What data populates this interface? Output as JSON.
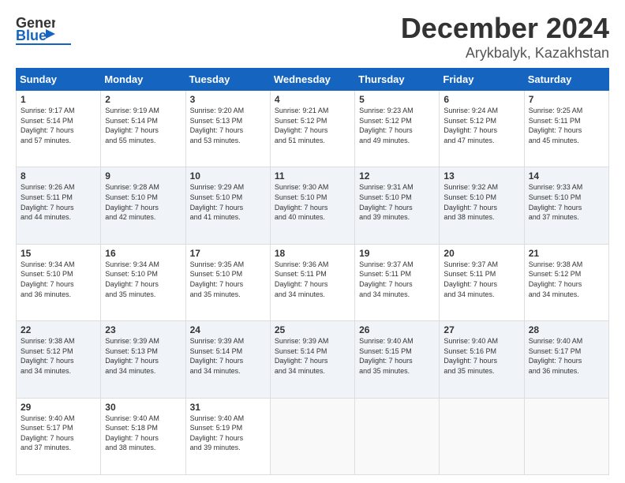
{
  "header": {
    "logo_line1": "General",
    "logo_line2": "Blue",
    "main_title": "December 2024",
    "subtitle": "Arykbalyk, Kazakhstan"
  },
  "calendar": {
    "headers": [
      "Sunday",
      "Monday",
      "Tuesday",
      "Wednesday",
      "Thursday",
      "Friday",
      "Saturday"
    ],
    "weeks": [
      [
        {
          "day": "",
          "info": ""
        },
        {
          "day": "2",
          "info": "Sunrise: 9:19 AM\nSunset: 5:14 PM\nDaylight: 7 hours\nand 55 minutes."
        },
        {
          "day": "3",
          "info": "Sunrise: 9:20 AM\nSunset: 5:13 PM\nDaylight: 7 hours\nand 53 minutes."
        },
        {
          "day": "4",
          "info": "Sunrise: 9:21 AM\nSunset: 5:12 PM\nDaylight: 7 hours\nand 51 minutes."
        },
        {
          "day": "5",
          "info": "Sunrise: 9:23 AM\nSunset: 5:12 PM\nDaylight: 7 hours\nand 49 minutes."
        },
        {
          "day": "6",
          "info": "Sunrise: 9:24 AM\nSunset: 5:12 PM\nDaylight: 7 hours\nand 47 minutes."
        },
        {
          "day": "7",
          "info": "Sunrise: 9:25 AM\nSunset: 5:11 PM\nDaylight: 7 hours\nand 45 minutes."
        }
      ],
      [
        {
          "day": "1",
          "info": "Sunrise: 9:17 AM\nSunset: 5:14 PM\nDaylight: 7 hours\nand 57 minutes."
        },
        null,
        null,
        null,
        null,
        null,
        null
      ],
      [
        {
          "day": "8",
          "info": "Sunrise: 9:26 AM\nSunset: 5:11 PM\nDaylight: 7 hours\nand 44 minutes."
        },
        {
          "day": "9",
          "info": "Sunrise: 9:28 AM\nSunset: 5:10 PM\nDaylight: 7 hours\nand 42 minutes."
        },
        {
          "day": "10",
          "info": "Sunrise: 9:29 AM\nSunset: 5:10 PM\nDaylight: 7 hours\nand 41 minutes."
        },
        {
          "day": "11",
          "info": "Sunrise: 9:30 AM\nSunset: 5:10 PM\nDaylight: 7 hours\nand 40 minutes."
        },
        {
          "day": "12",
          "info": "Sunrise: 9:31 AM\nSunset: 5:10 PM\nDaylight: 7 hours\nand 39 minutes."
        },
        {
          "day": "13",
          "info": "Sunrise: 9:32 AM\nSunset: 5:10 PM\nDaylight: 7 hours\nand 38 minutes."
        },
        {
          "day": "14",
          "info": "Sunrise: 9:33 AM\nSunset: 5:10 PM\nDaylight: 7 hours\nand 37 minutes."
        }
      ],
      [
        {
          "day": "15",
          "info": "Sunrise: 9:34 AM\nSunset: 5:10 PM\nDaylight: 7 hours\nand 36 minutes."
        },
        {
          "day": "16",
          "info": "Sunrise: 9:34 AM\nSunset: 5:10 PM\nDaylight: 7 hours\nand 35 minutes."
        },
        {
          "day": "17",
          "info": "Sunrise: 9:35 AM\nSunset: 5:10 PM\nDaylight: 7 hours\nand 35 minutes."
        },
        {
          "day": "18",
          "info": "Sunrise: 9:36 AM\nSunset: 5:11 PM\nDaylight: 7 hours\nand 34 minutes."
        },
        {
          "day": "19",
          "info": "Sunrise: 9:37 AM\nSunset: 5:11 PM\nDaylight: 7 hours\nand 34 minutes."
        },
        {
          "day": "20",
          "info": "Sunrise: 9:37 AM\nSunset: 5:11 PM\nDaylight: 7 hours\nand 34 minutes."
        },
        {
          "day": "21",
          "info": "Sunrise: 9:38 AM\nSunset: 5:12 PM\nDaylight: 7 hours\nand 34 minutes."
        }
      ],
      [
        {
          "day": "22",
          "info": "Sunrise: 9:38 AM\nSunset: 5:12 PM\nDaylight: 7 hours\nand 34 minutes."
        },
        {
          "day": "23",
          "info": "Sunrise: 9:39 AM\nSunset: 5:13 PM\nDaylight: 7 hours\nand 34 minutes."
        },
        {
          "day": "24",
          "info": "Sunrise: 9:39 AM\nSunset: 5:14 PM\nDaylight: 7 hours\nand 34 minutes."
        },
        {
          "day": "25",
          "info": "Sunrise: 9:39 AM\nSunset: 5:14 PM\nDaylight: 7 hours\nand 34 minutes."
        },
        {
          "day": "26",
          "info": "Sunrise: 9:40 AM\nSunset: 5:15 PM\nDaylight: 7 hours\nand 35 minutes."
        },
        {
          "day": "27",
          "info": "Sunrise: 9:40 AM\nSunset: 5:16 PM\nDaylight: 7 hours\nand 35 minutes."
        },
        {
          "day": "28",
          "info": "Sunrise: 9:40 AM\nSunset: 5:17 PM\nDaylight: 7 hours\nand 36 minutes."
        }
      ],
      [
        {
          "day": "29",
          "info": "Sunrise: 9:40 AM\nSunset: 5:17 PM\nDaylight: 7 hours\nand 37 minutes."
        },
        {
          "day": "30",
          "info": "Sunrise: 9:40 AM\nSunset: 5:18 PM\nDaylight: 7 hours\nand 38 minutes."
        },
        {
          "day": "31",
          "info": "Sunrise: 9:40 AM\nSunset: 5:19 PM\nDaylight: 7 hours\nand 39 minutes."
        },
        {
          "day": "",
          "info": ""
        },
        {
          "day": "",
          "info": ""
        },
        {
          "day": "",
          "info": ""
        },
        {
          "day": "",
          "info": ""
        }
      ]
    ]
  }
}
